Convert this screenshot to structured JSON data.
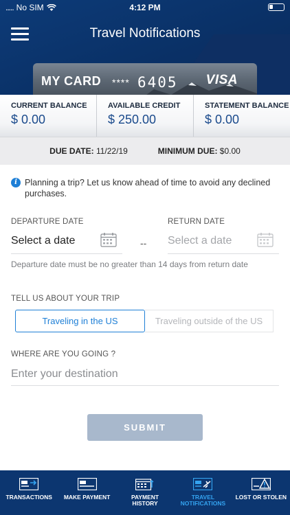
{
  "status_bar": {
    "carrier": "No SIM",
    "time": "4:12 PM"
  },
  "header": {
    "title": "Travel Notifications"
  },
  "card": {
    "name": "MY CARD",
    "masked": "****",
    "last_digits": "6405",
    "brand": "VISA"
  },
  "balances": [
    {
      "label": "CURRENT BALANCE",
      "value": "$ 0.00"
    },
    {
      "label": "AVAILABLE CREDIT",
      "value": "$ 250.00"
    },
    {
      "label": "STATEMENT BALANCE",
      "value": "$ 0.00"
    }
  ],
  "due": {
    "due_label": "DUE DATE:",
    "due_value": "11/22/19",
    "min_label": "MINIMUM DUE:",
    "min_value": "$0.00"
  },
  "info_text": "Planning a trip? Let us know ahead of time to avoid any declined purchases.",
  "departure": {
    "label": "DEPARTURE DATE",
    "value": "Select a date"
  },
  "return_date": {
    "label": "RETURN DATE",
    "placeholder": "Select a date"
  },
  "date_separator": "--",
  "date_hint": "Departure date must be no greater than 14 days from return date",
  "trip": {
    "label": "TELL US ABOUT YOUR TRIP",
    "options": [
      "Traveling in the US",
      "Traveling outside of the US"
    ],
    "selected": 0
  },
  "destination": {
    "label": "WHERE ARE YOU GOING ?",
    "placeholder": "Enter your destination"
  },
  "submit_label": "SUBMIT",
  "nav": [
    {
      "label": "TRANSACTIONS",
      "icon": "transactions-icon"
    },
    {
      "label": "MAKE PAYMENT",
      "icon": "payment-card-icon"
    },
    {
      "label": "PAYMENT\nHISTORY",
      "icon": "calendar-history-icon"
    },
    {
      "label": "TRAVEL\nNOTIFICATIONS",
      "icon": "travel-card-icon",
      "active": true
    },
    {
      "label": "LOST OR STOLEN",
      "icon": "warning-card-icon"
    }
  ],
  "colors": {
    "header": "#0a3167",
    "accent": "#1e7fd6",
    "nav_active": "#34a3f0",
    "submit": "#a8b8cc"
  }
}
